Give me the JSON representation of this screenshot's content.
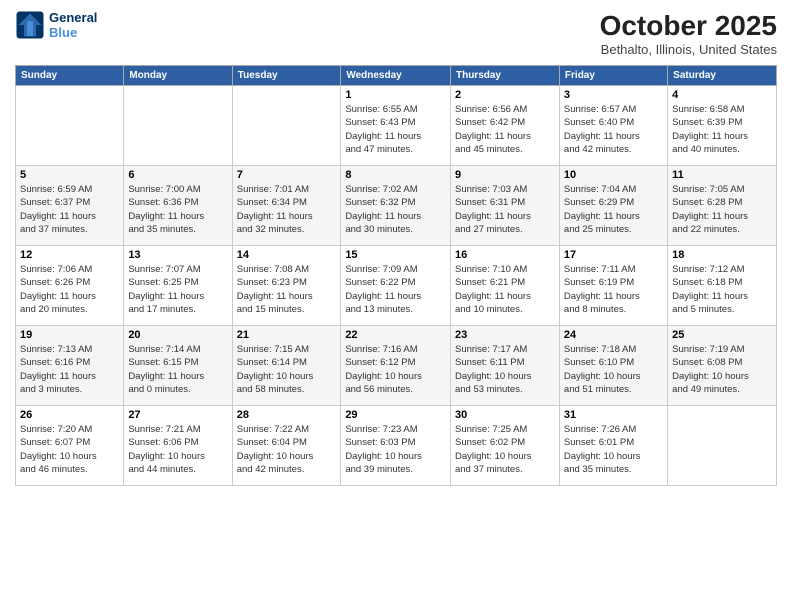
{
  "header": {
    "logo_line1": "General",
    "logo_line2": "Blue",
    "month": "October 2025",
    "location": "Bethalto, Illinois, United States"
  },
  "weekdays": [
    "Sunday",
    "Monday",
    "Tuesday",
    "Wednesday",
    "Thursday",
    "Friday",
    "Saturday"
  ],
  "weeks": [
    [
      {
        "day": "",
        "info": ""
      },
      {
        "day": "",
        "info": ""
      },
      {
        "day": "",
        "info": ""
      },
      {
        "day": "1",
        "info": "Sunrise: 6:55 AM\nSunset: 6:43 PM\nDaylight: 11 hours\nand 47 minutes."
      },
      {
        "day": "2",
        "info": "Sunrise: 6:56 AM\nSunset: 6:42 PM\nDaylight: 11 hours\nand 45 minutes."
      },
      {
        "day": "3",
        "info": "Sunrise: 6:57 AM\nSunset: 6:40 PM\nDaylight: 11 hours\nand 42 minutes."
      },
      {
        "day": "4",
        "info": "Sunrise: 6:58 AM\nSunset: 6:39 PM\nDaylight: 11 hours\nand 40 minutes."
      }
    ],
    [
      {
        "day": "5",
        "info": "Sunrise: 6:59 AM\nSunset: 6:37 PM\nDaylight: 11 hours\nand 37 minutes."
      },
      {
        "day": "6",
        "info": "Sunrise: 7:00 AM\nSunset: 6:36 PM\nDaylight: 11 hours\nand 35 minutes."
      },
      {
        "day": "7",
        "info": "Sunrise: 7:01 AM\nSunset: 6:34 PM\nDaylight: 11 hours\nand 32 minutes."
      },
      {
        "day": "8",
        "info": "Sunrise: 7:02 AM\nSunset: 6:32 PM\nDaylight: 11 hours\nand 30 minutes."
      },
      {
        "day": "9",
        "info": "Sunrise: 7:03 AM\nSunset: 6:31 PM\nDaylight: 11 hours\nand 27 minutes."
      },
      {
        "day": "10",
        "info": "Sunrise: 7:04 AM\nSunset: 6:29 PM\nDaylight: 11 hours\nand 25 minutes."
      },
      {
        "day": "11",
        "info": "Sunrise: 7:05 AM\nSunset: 6:28 PM\nDaylight: 11 hours\nand 22 minutes."
      }
    ],
    [
      {
        "day": "12",
        "info": "Sunrise: 7:06 AM\nSunset: 6:26 PM\nDaylight: 11 hours\nand 20 minutes."
      },
      {
        "day": "13",
        "info": "Sunrise: 7:07 AM\nSunset: 6:25 PM\nDaylight: 11 hours\nand 17 minutes."
      },
      {
        "day": "14",
        "info": "Sunrise: 7:08 AM\nSunset: 6:23 PM\nDaylight: 11 hours\nand 15 minutes."
      },
      {
        "day": "15",
        "info": "Sunrise: 7:09 AM\nSunset: 6:22 PM\nDaylight: 11 hours\nand 13 minutes."
      },
      {
        "day": "16",
        "info": "Sunrise: 7:10 AM\nSunset: 6:21 PM\nDaylight: 11 hours\nand 10 minutes."
      },
      {
        "day": "17",
        "info": "Sunrise: 7:11 AM\nSunset: 6:19 PM\nDaylight: 11 hours\nand 8 minutes."
      },
      {
        "day": "18",
        "info": "Sunrise: 7:12 AM\nSunset: 6:18 PM\nDaylight: 11 hours\nand 5 minutes."
      }
    ],
    [
      {
        "day": "19",
        "info": "Sunrise: 7:13 AM\nSunset: 6:16 PM\nDaylight: 11 hours\nand 3 minutes."
      },
      {
        "day": "20",
        "info": "Sunrise: 7:14 AM\nSunset: 6:15 PM\nDaylight: 11 hours\nand 0 minutes."
      },
      {
        "day": "21",
        "info": "Sunrise: 7:15 AM\nSunset: 6:14 PM\nDaylight: 10 hours\nand 58 minutes."
      },
      {
        "day": "22",
        "info": "Sunrise: 7:16 AM\nSunset: 6:12 PM\nDaylight: 10 hours\nand 56 minutes."
      },
      {
        "day": "23",
        "info": "Sunrise: 7:17 AM\nSunset: 6:11 PM\nDaylight: 10 hours\nand 53 minutes."
      },
      {
        "day": "24",
        "info": "Sunrise: 7:18 AM\nSunset: 6:10 PM\nDaylight: 10 hours\nand 51 minutes."
      },
      {
        "day": "25",
        "info": "Sunrise: 7:19 AM\nSunset: 6:08 PM\nDaylight: 10 hours\nand 49 minutes."
      }
    ],
    [
      {
        "day": "26",
        "info": "Sunrise: 7:20 AM\nSunset: 6:07 PM\nDaylight: 10 hours\nand 46 minutes."
      },
      {
        "day": "27",
        "info": "Sunrise: 7:21 AM\nSunset: 6:06 PM\nDaylight: 10 hours\nand 44 minutes."
      },
      {
        "day": "28",
        "info": "Sunrise: 7:22 AM\nSunset: 6:04 PM\nDaylight: 10 hours\nand 42 minutes."
      },
      {
        "day": "29",
        "info": "Sunrise: 7:23 AM\nSunset: 6:03 PM\nDaylight: 10 hours\nand 39 minutes."
      },
      {
        "day": "30",
        "info": "Sunrise: 7:25 AM\nSunset: 6:02 PM\nDaylight: 10 hours\nand 37 minutes."
      },
      {
        "day": "31",
        "info": "Sunrise: 7:26 AM\nSunset: 6:01 PM\nDaylight: 10 hours\nand 35 minutes."
      },
      {
        "day": "",
        "info": ""
      }
    ]
  ]
}
